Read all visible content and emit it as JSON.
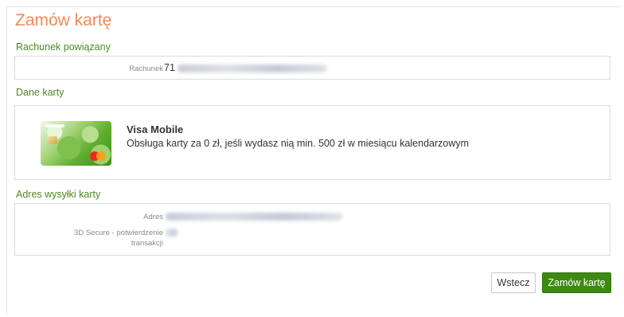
{
  "page": {
    "title": "Zamów kartę"
  },
  "linked_account": {
    "section_title": "Rachunek powiązany",
    "account_label": "Rachunek",
    "account_value": "71"
  },
  "card_data": {
    "section_title": "Dane karty",
    "card_name": "Visa Mobile",
    "card_description": "Obsługa karty za 0 zł, jeśli wydasz nią min. 500 zł w miesiącu kalendarzowym",
    "card_image_icon": "card-image-icon"
  },
  "shipping_address": {
    "section_title": "Adres wysyłki karty",
    "address_label": "Adres",
    "secure_label": "3D Secure - potwierdzenie transakcji"
  },
  "buttons": {
    "back_label": "Wstecz",
    "order_label": "Zamów kartę"
  },
  "colors": {
    "title": "#f08a5a",
    "section": "#4e8a1d",
    "primary_button": "#3d8a12"
  }
}
